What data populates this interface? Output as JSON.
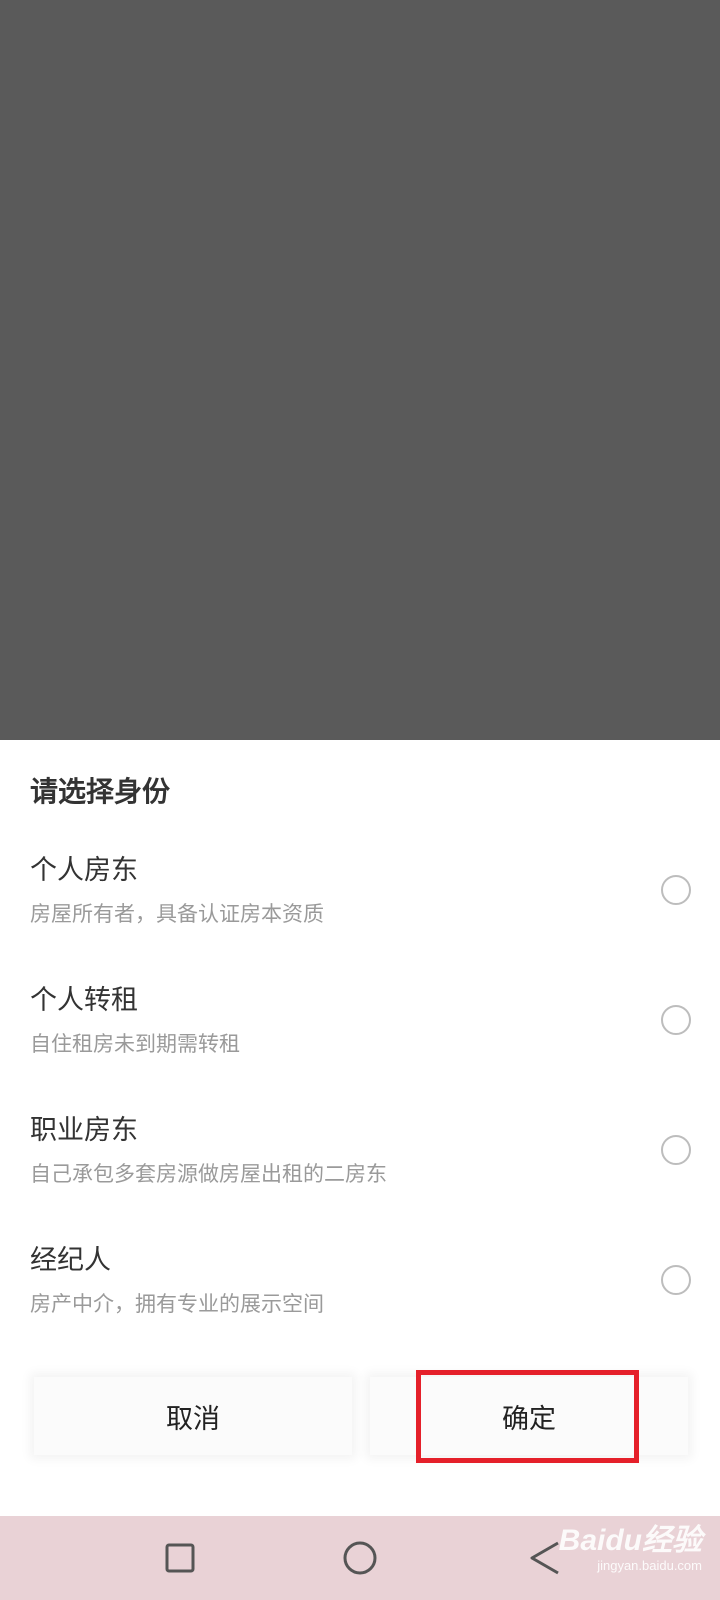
{
  "sheet": {
    "title": "请选择身份",
    "options": [
      {
        "title": "个人房东",
        "desc": "房屋所有者，具备认证房本资质",
        "selected": false
      },
      {
        "title": "个人转租",
        "desc": "自住租房未到期需转租",
        "selected": false
      },
      {
        "title": "职业房东",
        "desc": "自己承包多套房源做房屋出租的二房东",
        "selected": false
      },
      {
        "title": "经纪人",
        "desc": "房产中介，拥有专业的展示空间",
        "selected": false
      }
    ],
    "cancel_label": "取消",
    "confirm_label": "确定"
  },
  "colors": {
    "overlay": "#5a5a5a",
    "highlight": "#e5202a",
    "navbar": "#e9d2d6"
  },
  "navbar": {
    "icons": [
      "square-recent-apps-icon",
      "circle-home-icon",
      "triangle-back-icon"
    ]
  },
  "watermark": {
    "main": "Baidu经验",
    "sub": "jingyan.baidu.com"
  }
}
